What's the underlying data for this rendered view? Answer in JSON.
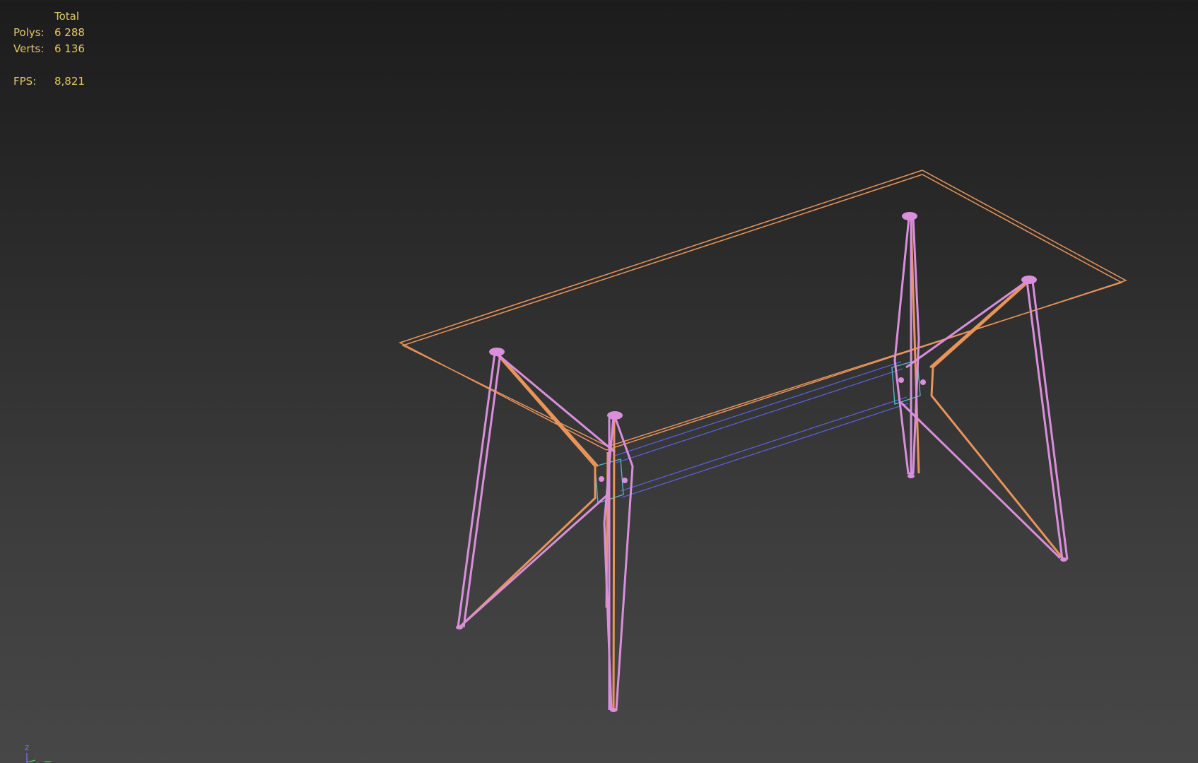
{
  "stats": {
    "header": "Total",
    "polys_label": "Polys:",
    "polys_value": "6 288",
    "verts_label": "Verts:",
    "verts_value": "6 136",
    "fps_label": "FPS:",
    "fps_value": "8,821"
  },
  "axis": {
    "z_label": "z"
  },
  "colors": {
    "stats_text": "#e3c766",
    "orange_wire": "#e8945a",
    "pink_wire": "#d98fdc",
    "blue_wire": "#5a5fd6",
    "cyan_wire": "#4fb7c8"
  }
}
